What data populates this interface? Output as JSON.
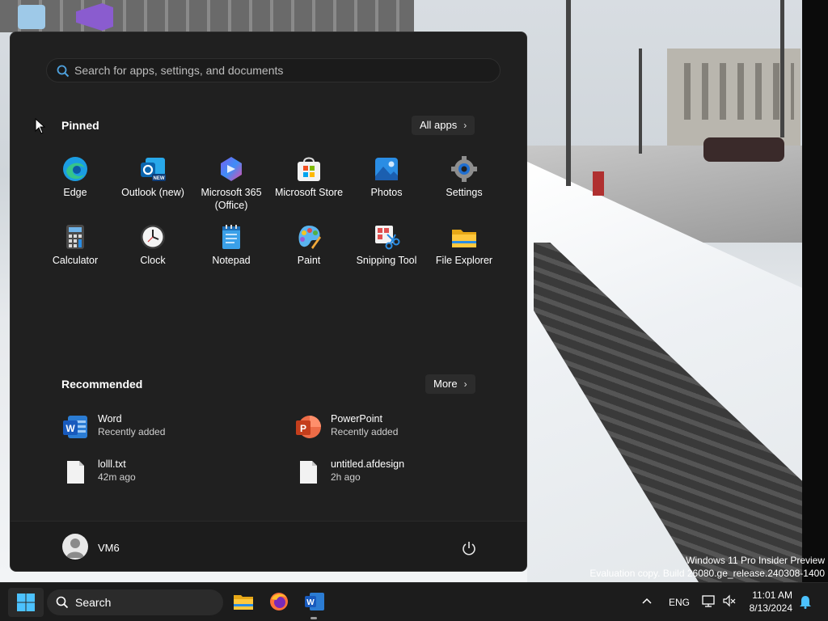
{
  "search": {
    "placeholder": "Search for apps, settings, and documents"
  },
  "pinned": {
    "title": "Pinned",
    "all_apps_label": "All apps",
    "apps": [
      {
        "label": "Edge",
        "icon": "edge-icon"
      },
      {
        "label": "Outlook (new)",
        "icon": "outlook-icon",
        "badge": "NEW"
      },
      {
        "label": "Microsoft 365 (Office)",
        "icon": "m365-icon"
      },
      {
        "label": "Microsoft Store",
        "icon": "store-icon"
      },
      {
        "label": "Photos",
        "icon": "photos-icon"
      },
      {
        "label": "Settings",
        "icon": "settings-icon"
      },
      {
        "label": "Calculator",
        "icon": "calculator-icon"
      },
      {
        "label": "Clock",
        "icon": "clock-icon"
      },
      {
        "label": "Notepad",
        "icon": "notepad-icon"
      },
      {
        "label": "Paint",
        "icon": "paint-icon"
      },
      {
        "label": "Snipping Tool",
        "icon": "snipping-tool-icon"
      },
      {
        "label": "File Explorer",
        "icon": "file-explorer-icon"
      }
    ]
  },
  "recommended": {
    "title": "Recommended",
    "more_label": "More",
    "items": [
      {
        "name": "Word",
        "detail": "Recently added",
        "icon": "word-icon"
      },
      {
        "name": "PowerPoint",
        "detail": "Recently added",
        "icon": "powerpoint-icon"
      },
      {
        "name": "lolll.txt",
        "detail": "42m ago",
        "icon": "file-icon"
      },
      {
        "name": "untitled.afdesign",
        "detail": "2h ago",
        "icon": "file-icon"
      }
    ]
  },
  "user": {
    "name": "VM6"
  },
  "taskbar": {
    "search_label": "Search",
    "language": "ENG",
    "time": "11:01 AM",
    "date": "8/13/2024"
  },
  "watermark": {
    "line1": "Windows 11 Pro Insider Preview",
    "line2": "Evaluation copy. Build 26080.ge_release.240308-1400"
  },
  "colors": {
    "accent": "#0078d4",
    "menu_bg": "#202020",
    "taskbar_bg": "#1c1c1c"
  }
}
